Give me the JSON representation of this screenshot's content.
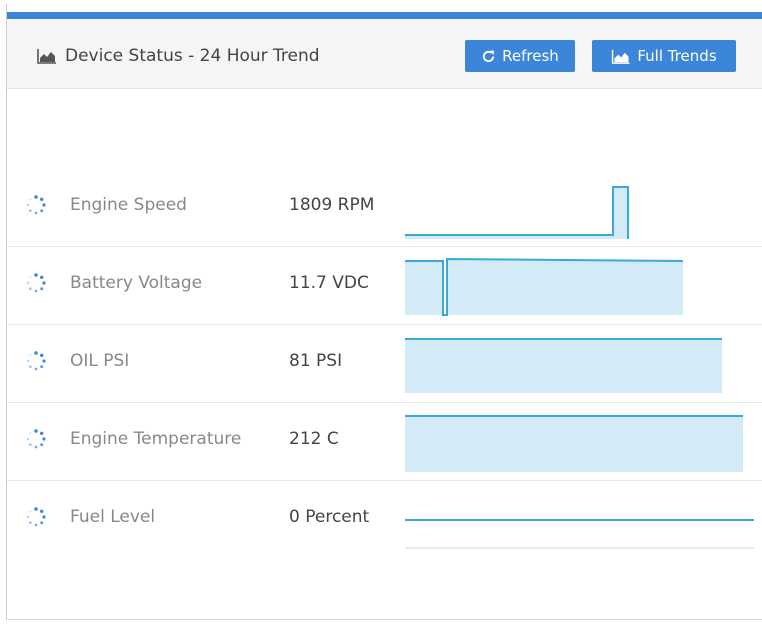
{
  "widget": {
    "title": "Device Status - 24 Hour Trend",
    "title_icon": "area-chart-icon",
    "accent_color": "#3b86d8",
    "buttons": {
      "refresh": {
        "label": "Refresh",
        "icon": "refresh-icon"
      },
      "full_trends": {
        "label": "Full Trends",
        "icon": "area-chart-icon"
      }
    }
  },
  "metrics": [
    {
      "label": "Engine Speed",
      "value": "1809 RPM",
      "status_icon": "loading-spinner-icon"
    },
    {
      "label": "Battery Voltage",
      "value": "11.7 VDC",
      "status_icon": "loading-spinner-icon"
    },
    {
      "label": "OIL PSI",
      "value": "81 PSI",
      "status_icon": "loading-spinner-icon"
    },
    {
      "label": "Engine Temperature",
      "value": "212 C",
      "status_icon": "loading-spinner-icon"
    },
    {
      "label": "Fuel Level",
      "value": "0 Percent",
      "status_icon": "loading-spinner-icon"
    }
  ]
}
